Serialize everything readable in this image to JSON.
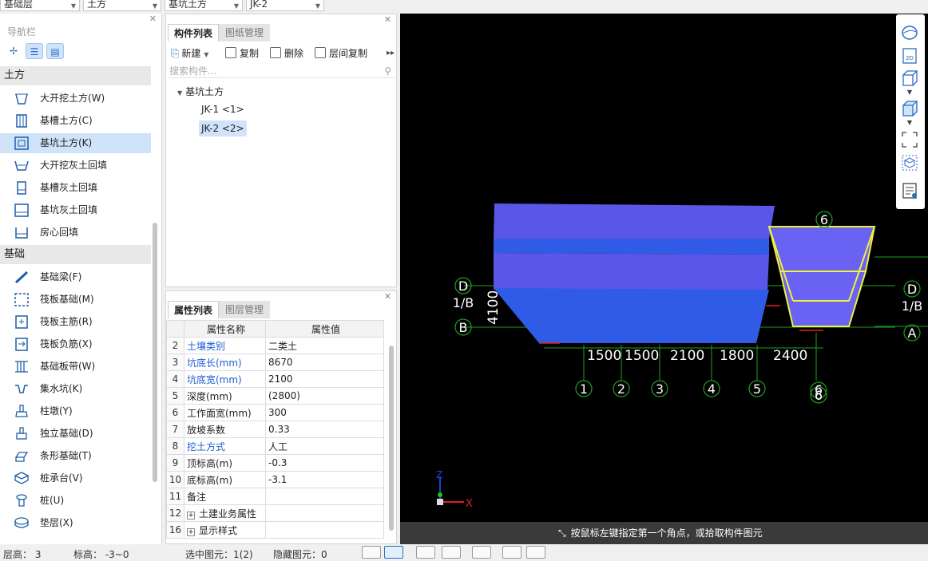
{
  "top_selectors": [
    {
      "value": "基础层"
    },
    {
      "value": "土方"
    },
    {
      "value": "基坑土方"
    },
    {
      "value": "JK-2"
    }
  ],
  "nav": {
    "title": "导航栏",
    "groups": [
      {
        "label": "土方",
        "items": [
          {
            "label": "大开挖土方(W)",
            "icon": "excavation-icon"
          },
          {
            "label": "基槽土方(C)",
            "icon": "trench-icon"
          },
          {
            "label": "基坑土方(K)",
            "icon": "pit-icon",
            "selected": true
          },
          {
            "label": "大开挖灰土回填",
            "icon": "lime-backfill-icon"
          },
          {
            "label": "基槽灰土回填",
            "icon": "trench-backfill-icon"
          },
          {
            "label": "基坑灰土回填",
            "icon": "pit-backfill-icon"
          },
          {
            "label": "房心回填",
            "icon": "room-backfill-icon"
          }
        ]
      },
      {
        "label": "基础",
        "items": [
          {
            "label": "基础梁(F)",
            "icon": "foundation-beam-icon"
          },
          {
            "label": "筏板基础(M)",
            "icon": "raft-icon"
          },
          {
            "label": "筏板主筋(R)",
            "icon": "raft-main-rebar-icon"
          },
          {
            "label": "筏板负筋(X)",
            "icon": "raft-neg-rebar-icon"
          },
          {
            "label": "基础板带(W)",
            "icon": "slab-strip-icon"
          },
          {
            "label": "集水坑(K)",
            "icon": "sump-icon"
          },
          {
            "label": "柱墩(Y)",
            "icon": "column-pier-icon"
          },
          {
            "label": "独立基础(D)",
            "icon": "isolated-footing-icon"
          },
          {
            "label": "条形基础(T)",
            "icon": "strip-footing-icon"
          },
          {
            "label": "桩承台(V)",
            "icon": "pile-cap-icon"
          },
          {
            "label": "桩(U)",
            "icon": "pile-icon"
          },
          {
            "label": "垫层(X)",
            "icon": "cushion-icon"
          }
        ]
      }
    ]
  },
  "component_panel": {
    "tabs": [
      "构件列表",
      "图纸管理"
    ],
    "toolbar": {
      "new": "新建",
      "copy": "复制",
      "delete": "删除",
      "floor_copy": "层间复制"
    },
    "search_placeholder": "搜索构件...",
    "tree_root": "基坑土方",
    "tree_items": [
      {
        "label": "JK-1 <1>",
        "selected": false
      },
      {
        "label": "JK-2 <2>",
        "selected": true
      }
    ]
  },
  "property_panel": {
    "tabs": [
      "属性列表",
      "图层管理"
    ],
    "headers": [
      "属性名称",
      "属性值"
    ],
    "rows": [
      {
        "no": "2",
        "name": "土壤类别",
        "value": "二类土",
        "blue": true
      },
      {
        "no": "3",
        "name": "坑底长(mm)",
        "value": "8670",
        "blue": true
      },
      {
        "no": "4",
        "name": "坑底宽(mm)",
        "value": "2100",
        "blue": true
      },
      {
        "no": "5",
        "name": "深度(mm)",
        "value": "(2800)",
        "blue": false
      },
      {
        "no": "6",
        "name": "工作面宽(mm)",
        "value": "300",
        "blue": false
      },
      {
        "no": "7",
        "name": "放坡系数",
        "value": "0.33",
        "blue": false
      },
      {
        "no": "8",
        "name": "挖土方式",
        "value": "人工",
        "blue": true
      },
      {
        "no": "9",
        "name": "顶标高(m)",
        "value": "-0.3",
        "blue": false
      },
      {
        "no": "10",
        "name": "底标高(m)",
        "value": "-3.1",
        "blue": false
      },
      {
        "no": "11",
        "name": "备注",
        "value": "",
        "blue": false
      },
      {
        "no": "12",
        "name": "土建业务属性",
        "value": "",
        "blue": false,
        "expand": true
      },
      {
        "no": "16",
        "name": "显示样式",
        "value": "",
        "blue": false,
        "expand": true
      }
    ]
  },
  "viewport": {
    "status_text": "按鼠标左键指定第一个角点，或拾取构件图元",
    "dims": [
      "1500",
      "1500",
      "2100",
      "1800",
      "2400"
    ],
    "vertical_dim": "4100",
    "axis_numbers": [
      "1",
      "2",
      "3",
      "4",
      "5",
      "6",
      "6",
      "6"
    ],
    "axis_letters_left": [
      "D",
      "1/B",
      "B",
      "A"
    ],
    "axis_letters_right": [
      "D",
      "1/B",
      "A"
    ],
    "axis_x": "X",
    "axis_z": "Z",
    "colors": {
      "pit_fill": "#3a5fe6",
      "pit_face": "#6a6cf0",
      "selected_outline": "#f0f040",
      "grid": "#1fa01f"
    }
  },
  "bottom_bar": {
    "floor_height": "层高： 3",
    "elevation": "标高： -3~0",
    "selected": "选中图元：1(2)",
    "hidden": "隐藏图元：0"
  }
}
